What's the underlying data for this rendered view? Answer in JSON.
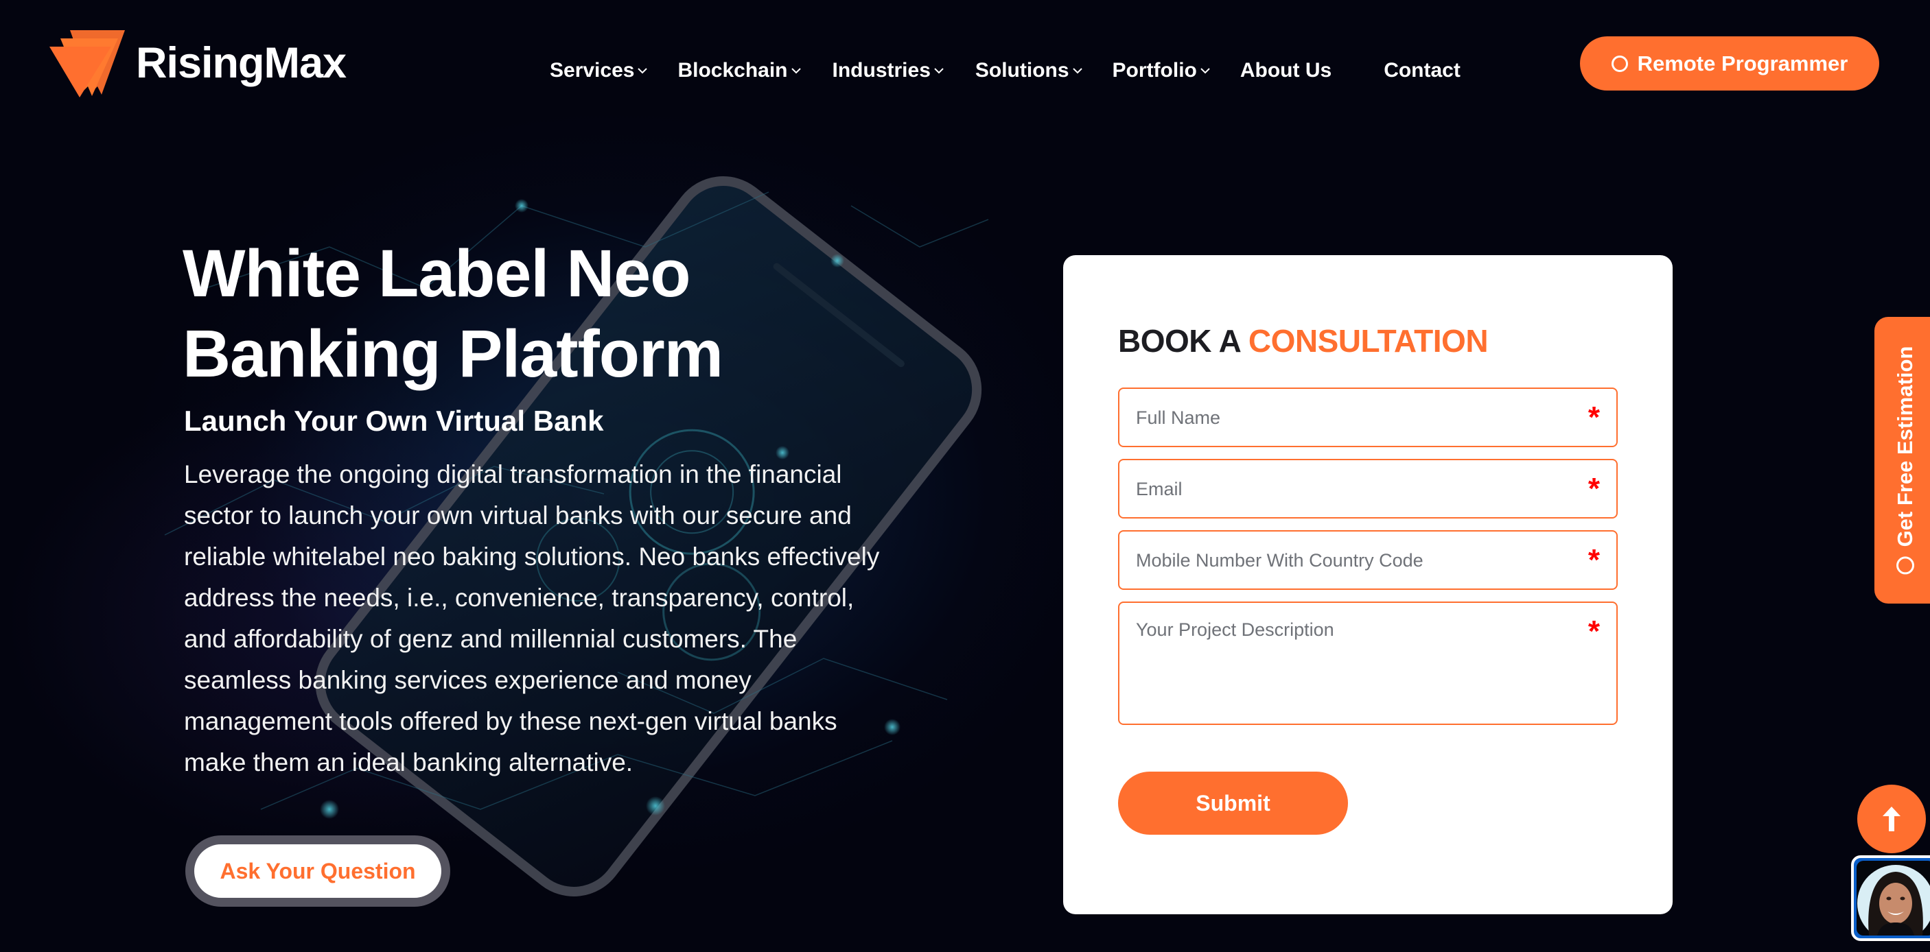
{
  "brand": {
    "name": "RisingMax",
    "logo_icon": "rising-triangle-logo-icon",
    "accent_color": "#ff6f2f",
    "background_color": "#03040f"
  },
  "nav": {
    "items": [
      {
        "label": "Services",
        "has_dropdown": true
      },
      {
        "label": "Blockchain",
        "has_dropdown": true
      },
      {
        "label": "Industries",
        "has_dropdown": true
      },
      {
        "label": "Solutions",
        "has_dropdown": true
      },
      {
        "label": "Portfolio",
        "has_dropdown": true
      },
      {
        "label": "About Us",
        "has_dropdown": false
      },
      {
        "label": "Contact",
        "has_dropdown": false
      }
    ],
    "cta_label": "Remote Programmer",
    "cta_icon": "circle-icon"
  },
  "hero": {
    "title_line1": "White Label Neo",
    "title_line2": "Banking Platform",
    "subtitle": "Launch Your Own Virtual Bank",
    "paragraph_lines": [
      "Leverage the ongoing digital transformation in the financial",
      "sector to launch your own virtual banks with our secure and",
      "reliable whitelabel neo baking solutions. Neo banks effectively",
      "address the needs, i.e., convenience, transparency, control,",
      "and affordability of genz and millennial customers. The",
      "seamless banking services experience and money",
      "management tools offered by these next-gen virtual banks",
      "make them an ideal banking alternative."
    ],
    "button_label": "Ask Your Question"
  },
  "form": {
    "title_prefix": "BOOK A",
    "title_accent": "CONSULTATION",
    "fields": [
      {
        "placeholder": "Full Name",
        "value": "",
        "required": true,
        "required_mark": "*"
      },
      {
        "placeholder": "Email",
        "value": "",
        "required": true,
        "required_mark": "*"
      },
      {
        "placeholder": "Mobile Number With Country Code",
        "value": "",
        "required": true,
        "required_mark": "*"
      },
      {
        "placeholder": "Your Project Description",
        "value": "",
        "required": true,
        "required_mark": "*"
      }
    ],
    "submit_label": "Submit",
    "required_color": "#ff0000"
  },
  "side_tab": {
    "label": "Get Free Estimation",
    "icon": "circle-icon"
  },
  "floating": {
    "back_to_top_icon": "arrow-up-icon",
    "chat_avatar": "support-agent-avatar"
  }
}
